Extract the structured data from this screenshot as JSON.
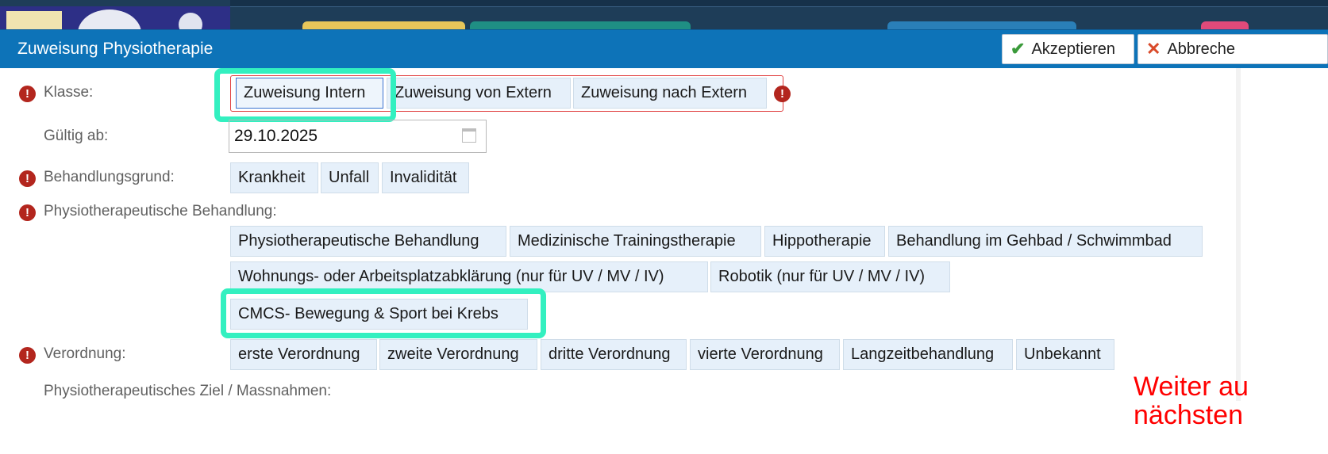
{
  "dialog": {
    "title": "Zuweisung Physiotherapie",
    "accept_label": "Akzeptieren",
    "cancel_label": "Abbreche"
  },
  "form": {
    "klasse": {
      "label": "Klasse:",
      "options": [
        "Zuweisung Intern",
        "Zuweisung von Extern",
        "Zuweisung nach Extern"
      ],
      "selected": "Zuweisung Intern"
    },
    "gueltig": {
      "label": "Gültig ab:",
      "value": "29.10.2025"
    },
    "behandlungsgrund": {
      "label": "Behandlungsgrund:",
      "options": [
        "Krankheit",
        "Unfall",
        "Invalidität"
      ]
    },
    "physio": {
      "label": "Physiotherapeutische Behandlung:",
      "options": [
        "Physiotherapeutische Behandlung",
        "Medizinische Trainingstherapie",
        "Hippotherapie",
        "Behandlung im Gehbad / Schwimmbad",
        "Wohnungs- oder Arbeitsplatzabklärung (nur für UV / MV / IV)",
        "Robotik (nur für UV / MV / IV)",
        "CMCS- Bewegung & Sport bei Krebs"
      ],
      "highlighted": "CMCS- Bewegung & Sport bei Krebs"
    },
    "verordnung": {
      "label": "Verordnung:",
      "options": [
        "erste Verordnung",
        "zweite Verordnung",
        "dritte Verordnung",
        "vierte Verordnung",
        "Langzeitbehandlung",
        "Unbekannt"
      ]
    },
    "ziel": {
      "label": "Physiotherapeutisches Ziel / Massnahmen:"
    }
  },
  "annotation": {
    "line1": "Weiter au",
    "line2": "nächsten"
  },
  "colors": {
    "titlebar": "#0d73b8",
    "chip_bg": "#e6f0fa",
    "required": "#b3261e",
    "highlight": "#33f0c0",
    "annotation": "#ff0000"
  }
}
